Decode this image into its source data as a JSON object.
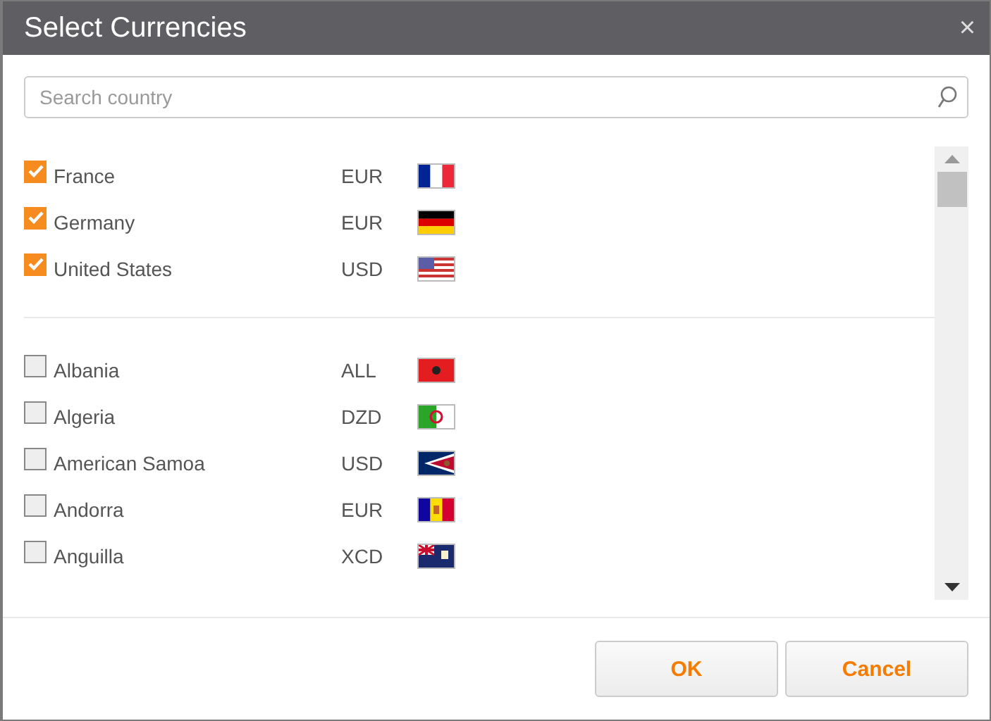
{
  "window": {
    "title": "Select Currencies",
    "close": "×"
  },
  "search": {
    "placeholder": "Search country"
  },
  "selected_countries": [
    {
      "name": "France",
      "currency": "EUR",
      "checked": true
    },
    {
      "name": "Germany",
      "currency": "EUR",
      "checked": true
    },
    {
      "name": "United States",
      "currency": "USD",
      "checked": true
    }
  ],
  "countries": [
    {
      "name": "Albania",
      "currency": "ALL",
      "checked": false
    },
    {
      "name": "Algeria",
      "currency": "DZD",
      "checked": false
    },
    {
      "name": "American Samoa",
      "currency": "USD",
      "checked": false
    },
    {
      "name": "Andorra",
      "currency": "EUR",
      "checked": false
    },
    {
      "name": "Anguilla",
      "currency": "XCD",
      "checked": false
    }
  ],
  "buttons": [
    "OK",
    "Cancel"
  ]
}
